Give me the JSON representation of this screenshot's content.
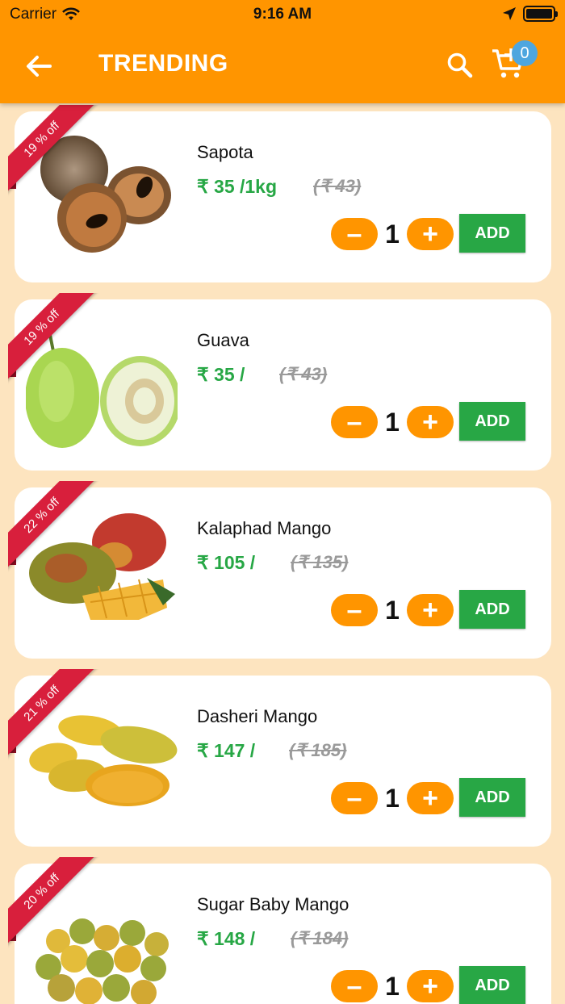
{
  "status_bar": {
    "carrier": "Carrier",
    "time": "9:16 AM"
  },
  "header": {
    "title": "TRENDING",
    "cart_count": "0",
    "background_color": "#ff9500"
  },
  "colors": {
    "accent": "#ff9500",
    "price_green": "#27a745",
    "add_button": "#28a745",
    "ribbon_red": "#d81f3c",
    "page_background": "#fde4bf"
  },
  "products": [
    {
      "name": "Sapota",
      "price": "₹ 35 /1kg",
      "mrp": "(₹ 43)",
      "discount": "19 % off",
      "quantity": "1",
      "add_label": "ADD",
      "image": "sapota-fruit-image"
    },
    {
      "name": "Guava",
      "price": "₹ 35 /",
      "mrp": "(₹ 43)",
      "discount": "19 % off",
      "quantity": "1",
      "add_label": "ADD",
      "image": "guava-fruit-image"
    },
    {
      "name": "Kalaphad Mango",
      "price": "₹ 105 /",
      "mrp": "(₹ 135)",
      "discount": "22 % off",
      "quantity": "1",
      "add_label": "ADD",
      "image": "mango-fruit-image"
    },
    {
      "name": "Dasheri Mango",
      "price": "₹ 147 /",
      "mrp": "(₹ 185)",
      "discount": "21 % off",
      "quantity": "1",
      "add_label": "ADD",
      "image": "mango-fruit-image"
    },
    {
      "name": "Sugar Baby Mango",
      "price": "₹ 148 /",
      "mrp": "(₹ 184)",
      "discount": "20 % off",
      "quantity": "1",
      "add_label": "ADD",
      "image": "mango-fruit-image"
    }
  ]
}
